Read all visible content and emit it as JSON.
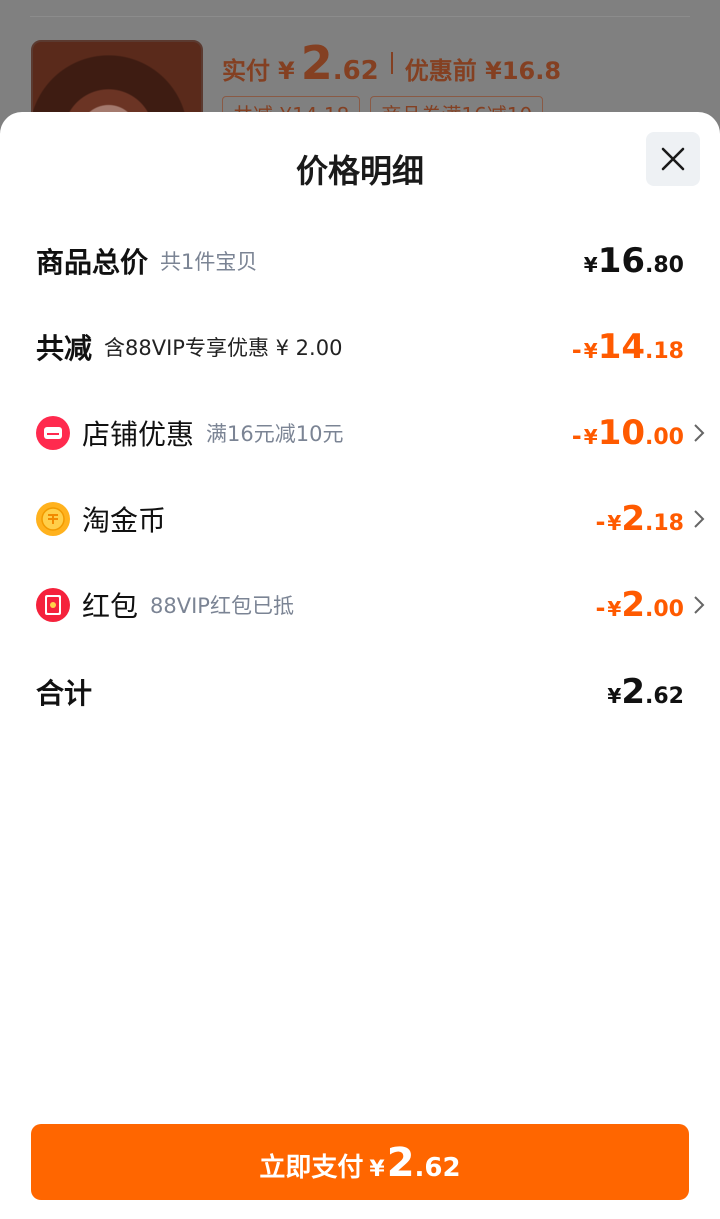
{
  "background": {
    "price_label": "实付",
    "currency": "¥",
    "price_int": "2",
    "price_dec": ".62",
    "before_label": "优惠前 ¥16.8",
    "tags": [
      "共减 ¥14.18",
      "商品券满16减10"
    ]
  },
  "sheet": {
    "title": "价格明细",
    "close_icon": "close-icon",
    "rows": {
      "total": {
        "title": "商品总价",
        "sub": "共1件宝贝",
        "currency": "¥",
        "int": "16",
        "dec": ".80"
      },
      "reduce": {
        "title": "共减",
        "sub": "含88VIP专享优惠 ¥ 2.00",
        "sign": "-",
        "currency": "¥",
        "int": "14",
        "dec": ".18"
      },
      "shop": {
        "title": "店铺优惠",
        "sub": "满16元减10元",
        "sign": "-",
        "currency": "¥",
        "int": "10",
        "dec": ".00",
        "icon": "shop-icon"
      },
      "coin": {
        "title": "淘金币",
        "sign": "-",
        "currency": "¥",
        "int": "2",
        "dec": ".18",
        "icon": "coin-icon"
      },
      "redpacket": {
        "title": "红包",
        "sub": "88VIP红包已抵",
        "sign": "-",
        "currency": "¥",
        "int": "2",
        "dec": ".00",
        "icon": "red-packet-icon"
      },
      "sum": {
        "title": "合计",
        "currency": "¥",
        "int": "2",
        "dec": ".62"
      }
    },
    "pay_button": {
      "label": "立即支付",
      "currency": "¥",
      "int": "2",
      "dec": ".62"
    }
  },
  "colors": {
    "accent": "#ff6600",
    "discount": "#ff5a00",
    "shop_icon": "#ff2a4e",
    "coin_icon": "#ffb21e",
    "red_packet_icon": "#f5223c"
  }
}
